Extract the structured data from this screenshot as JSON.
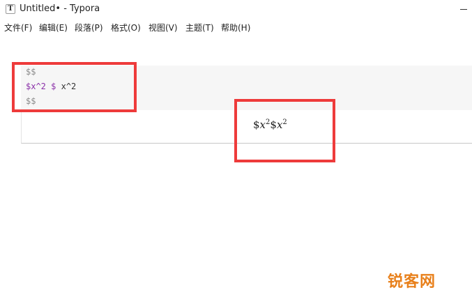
{
  "window": {
    "icon_letter": "T",
    "title": "Untitled• - Typora"
  },
  "menu": {
    "items": [
      {
        "label": "文件(F)"
      },
      {
        "label": "编辑(E)"
      },
      {
        "label": "段落(P)"
      },
      {
        "label": "格式(O)"
      },
      {
        "label": "视图(V)"
      },
      {
        "label": "主题(T)"
      },
      {
        "label": "帮助(H)"
      }
    ]
  },
  "editor": {
    "source": {
      "open_delim": "$$",
      "line_dollar_1": "$",
      "line_text_1": "x^2 ",
      "line_dollar_2": "$",
      "line_text_2": " x^2",
      "close_delim": "$$"
    },
    "preview": {
      "dollar_1": "$",
      "var_1": "x",
      "exp_1": "2",
      "dollar_2": "$",
      "var_2": "x",
      "exp_2": "2"
    }
  },
  "watermark": {
    "text": "锐客网"
  },
  "colors": {
    "highlight": "#ee3b3b",
    "math_dollar": "#8a2fa8",
    "watermark": "#e8801b"
  }
}
